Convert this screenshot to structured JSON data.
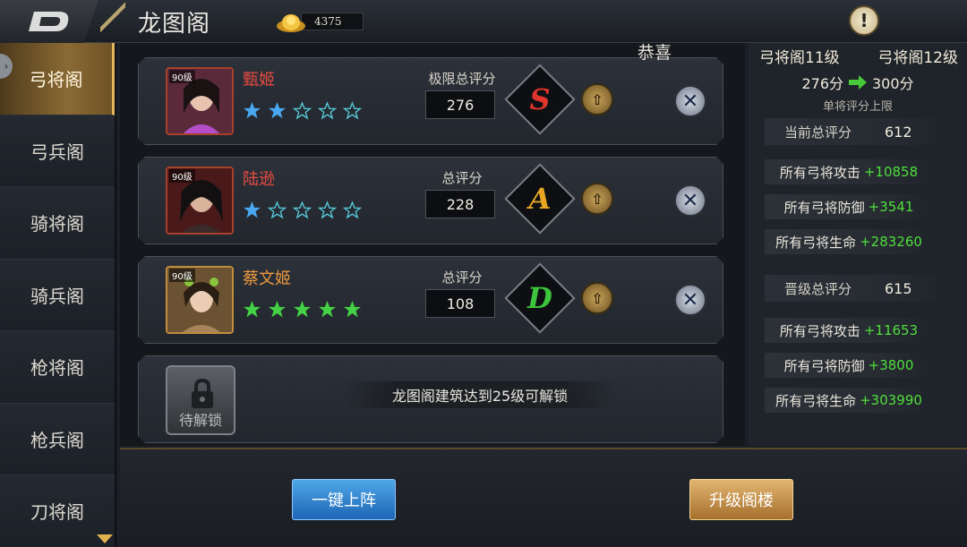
{
  "header": {
    "title": "龙图阁",
    "gold": "4375",
    "congrats": "恭喜"
  },
  "sidebar": {
    "items": [
      {
        "label": "弓将阁",
        "active": true
      },
      {
        "label": "弓兵阁",
        "active": false
      },
      {
        "label": "骑将阁",
        "active": false
      },
      {
        "label": "骑兵阁",
        "active": false
      },
      {
        "label": "枪将阁",
        "active": false
      },
      {
        "label": "枪兵阁",
        "active": false
      },
      {
        "label": "刀将阁",
        "active": false
      }
    ]
  },
  "heroes": [
    {
      "level": "90级",
      "name": "甄姬",
      "stars": 2,
      "score_label": "极限总评分",
      "score": "276",
      "grade": "S",
      "grade_color": "#e0342c"
    },
    {
      "level": "90级",
      "name": "陆逊",
      "stars": 1,
      "score_label": "总评分",
      "score": "228",
      "grade": "A",
      "grade_color": "#e8a624"
    },
    {
      "level": "90级",
      "name": "蔡文姬",
      "stars": 5,
      "score_label": "总评分",
      "score": "108",
      "grade": "D",
      "grade_color": "#3cc43c"
    }
  ],
  "locked_slot": {
    "label": "待解锁",
    "message": "龙图阁建筑达到25级可解锁"
  },
  "right_panel": {
    "current_level": "弓将阁11级",
    "next_level": "弓将阁12级",
    "cap_from": "276分",
    "cap_to": "300分",
    "cap_label": "单将评分上限",
    "current_total_label": "当前总评分",
    "current_total": "612",
    "current_stats": [
      {
        "label": "所有弓将攻击",
        "value": "+10858"
      },
      {
        "label": "所有弓将防御",
        "value": "+3541"
      },
      {
        "label": "所有弓将生命",
        "value": "+283260"
      }
    ],
    "next_total_label": "晋级总评分",
    "next_total": "615",
    "next_stats": [
      {
        "label": "所有弓将攻击",
        "value": "+11653"
      },
      {
        "label": "所有弓将防御",
        "value": "+3800"
      },
      {
        "label": "所有弓将生命",
        "value": "+303990"
      }
    ]
  },
  "buttons": {
    "deploy": "一键上阵",
    "upgrade": "升级阁楼"
  },
  "colors": {
    "star_active": "#4aa8f0",
    "star_green": "#45d145",
    "stat_green": "#4fe03c",
    "name_red": "#ea4a3f",
    "name_orange": "#ef9a3c"
  }
}
